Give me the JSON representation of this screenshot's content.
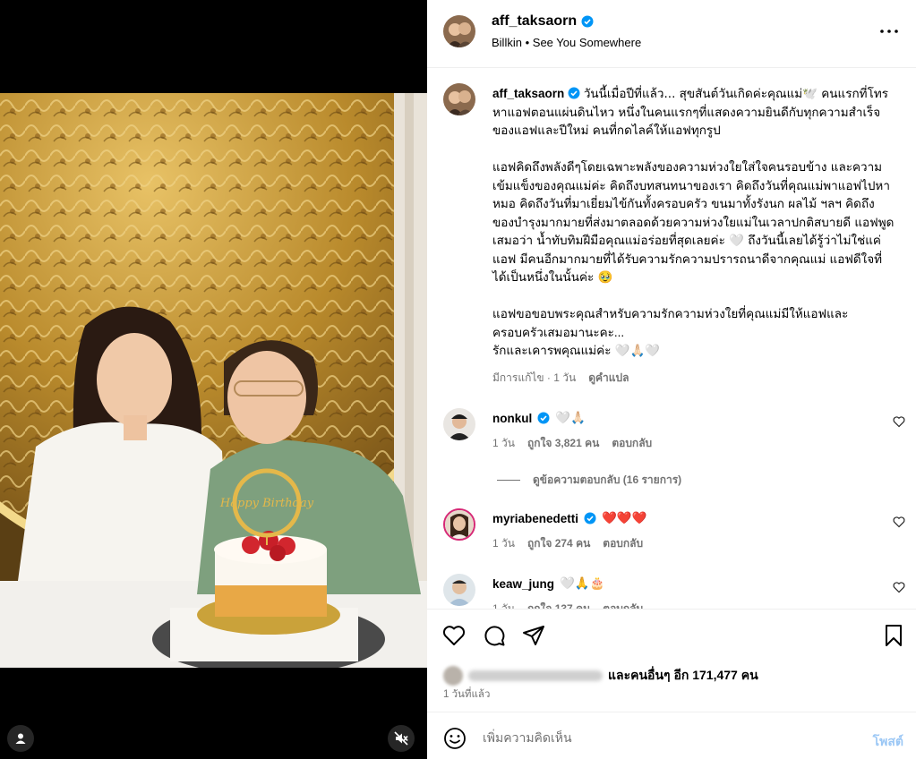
{
  "post": {
    "username": "aff_taksaorn",
    "music_artist": "Billkin",
    "music_separator": "•",
    "music_title": "See You Somewhere",
    "caption_p1": "วันนี้เมื่อปีที่แล้ว... สุขสันต์วันเกิดค่ะคุณแม่🕊️ คนแรกที่โทรหาแอฟตอนแผ่นดินไหว หนึ่งในคนแรกๆที่แสดงความยินดีกับทุกความสำเร็จของแอฟและปีใหม่ คนที่กดไลค์ให้แอฟทุกรูป",
    "caption_p2": "แอฟคิดถึงพลังดีๆโดยเฉพาะพลังของความห่วงใยใส่ใจคนรอบข้าง และความเข้มแข็งของคุณแม่ค่ะ คิดถึงบทสนทนาของเรา คิดถึงวันที่คุณแม่พาแอฟไปหาหมอ คิดถึงวันที่มาเยี่ยมไข้กันทั้งครอบครัว ขนมาทั้งรังนก ผลไม้ ฯลฯ คิดถึงของบำรุงมากมายที่ส่งมาตลอดด้วยความห่วงใยแม่ในเวลาปกติสบายดี แอฟพูดเสมอว่า น้ำทับทิมฝีมือคุณแม่อร่อยที่สุดเลยค่ะ 🤍 ถึงวันนี้เลยได้รู้ว่าไม่ใช่แค่แอฟ มีคนอีกมากมายที่ได้รับความรักความปรารถนาดีจากคุณแม่ แอฟดีใจที่ได้เป็นหนึ่งในนั้นค่ะ 🥹",
    "caption_p3": "แอฟขอขอบพระคุณสำหรับความรักความห่วงใยที่คุณแม่มีให้แอฟและครอบครัวเสมอมานะคะ...",
    "caption_p4": "รักและเคารพคุณแม่ค่ะ 🤍🙏🏻🤍",
    "edited_label": "มีการแก้ไข · 1 วัน",
    "translate_label": "ดูคำแปล",
    "likes_text": "และคนอื่นๆ อีก 171,477 คน",
    "time_ago": "1 วันที่แล้ว"
  },
  "comments": [
    {
      "username": "nonkul",
      "verified": true,
      "text": "🤍🙏🏻",
      "time": "1 วัน",
      "likes": "ถูกใจ 3,821 คน",
      "reply": "ตอบกลับ"
    },
    {
      "username": "myriabenedetti",
      "verified": true,
      "text": "❤️❤️❤️",
      "time": "1 วัน",
      "likes": "ถูกใจ 274 คน",
      "reply": "ตอบกลับ"
    },
    {
      "username": "keaw_jung",
      "verified": false,
      "text": "🤍🙏🎂",
      "time": "1 วัน",
      "likes": "ถูกใจ 137 คน",
      "reply": "ตอบกลับ"
    }
  ],
  "view_replies": "ดูข้อความตอบกลับ (16 รายการ)",
  "compose": {
    "placeholder": "เพิ่มความคิดเห็น",
    "post_label": "โพสต์"
  },
  "photo": {
    "cake_topper": "Happy Birthday"
  },
  "colors": {
    "verified": "#0095f6",
    "secondary_text": "#737373",
    "post_button": "#9bc7f5",
    "heart": "#ed4956"
  }
}
